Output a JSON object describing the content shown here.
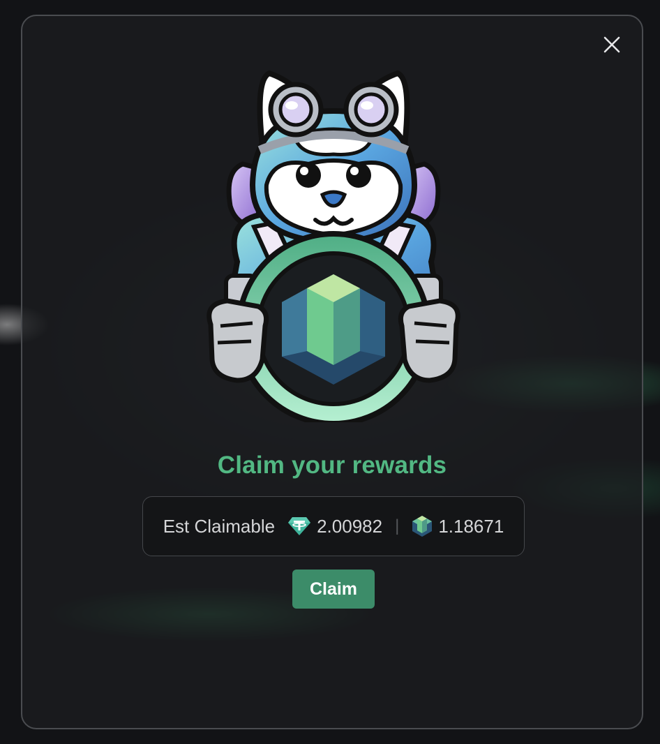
{
  "modal": {
    "title": "Claim your rewards",
    "close_icon": "close-icon",
    "mascot_icon": "red-panda-mascot-holding-cube-coin"
  },
  "claimable": {
    "label": "Est Claimable",
    "tokens": [
      {
        "icon": "tether-usdt-icon",
        "amount": "2.00982",
        "color": "#3fb49c"
      },
      {
        "icon": "cube-token-icon",
        "amount": "1.18671",
        "color": "#6fc98b"
      }
    ],
    "separator": "|"
  },
  "actions": {
    "claim_label": "Claim"
  },
  "colors": {
    "accent": "#52b883",
    "button": "#3c8c69",
    "panel_bg": "#1c1d20",
    "box_bg": "#141517"
  }
}
